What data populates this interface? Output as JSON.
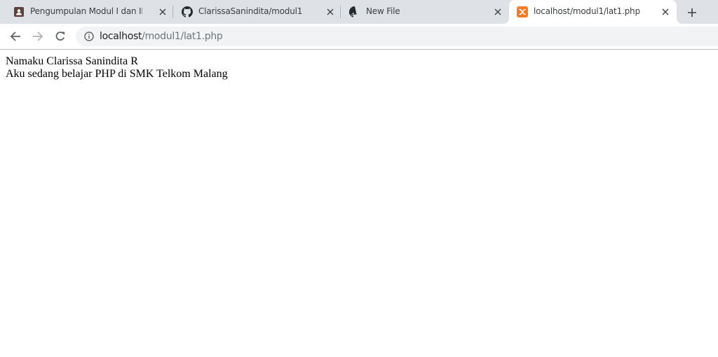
{
  "tabs": [
    {
      "title": "Pengumpulan Modul I dan II",
      "icon": "classroom-icon",
      "active": false
    },
    {
      "title": "ClarissaSanindita/modul1",
      "icon": "github-icon",
      "active": false
    },
    {
      "title": "New File",
      "icon": "github-icon",
      "active": false
    },
    {
      "title": "localhost/modul1/lat1.php",
      "icon": "xampp-icon",
      "active": true
    }
  ],
  "toolbar": {
    "back_icon": "arrow-left-icon",
    "forward_icon": "arrow-right-icon",
    "reload_icon": "reload-icon",
    "info_icon": "info-icon",
    "new_tab_icon": "plus-icon"
  },
  "address_bar": {
    "host": "localhost",
    "path": "/modul1/lat1.php"
  },
  "page": {
    "lines": [
      "Namaku Clarissa Sanindita R",
      "Aku sedang belajar PHP di SMK Telkom Malang"
    ]
  },
  "colors": {
    "tabstrip": "#dee1e6",
    "omnibox": "#f1f3f4",
    "xampp": "#fb7a24",
    "classroom": "#5f4339"
  }
}
